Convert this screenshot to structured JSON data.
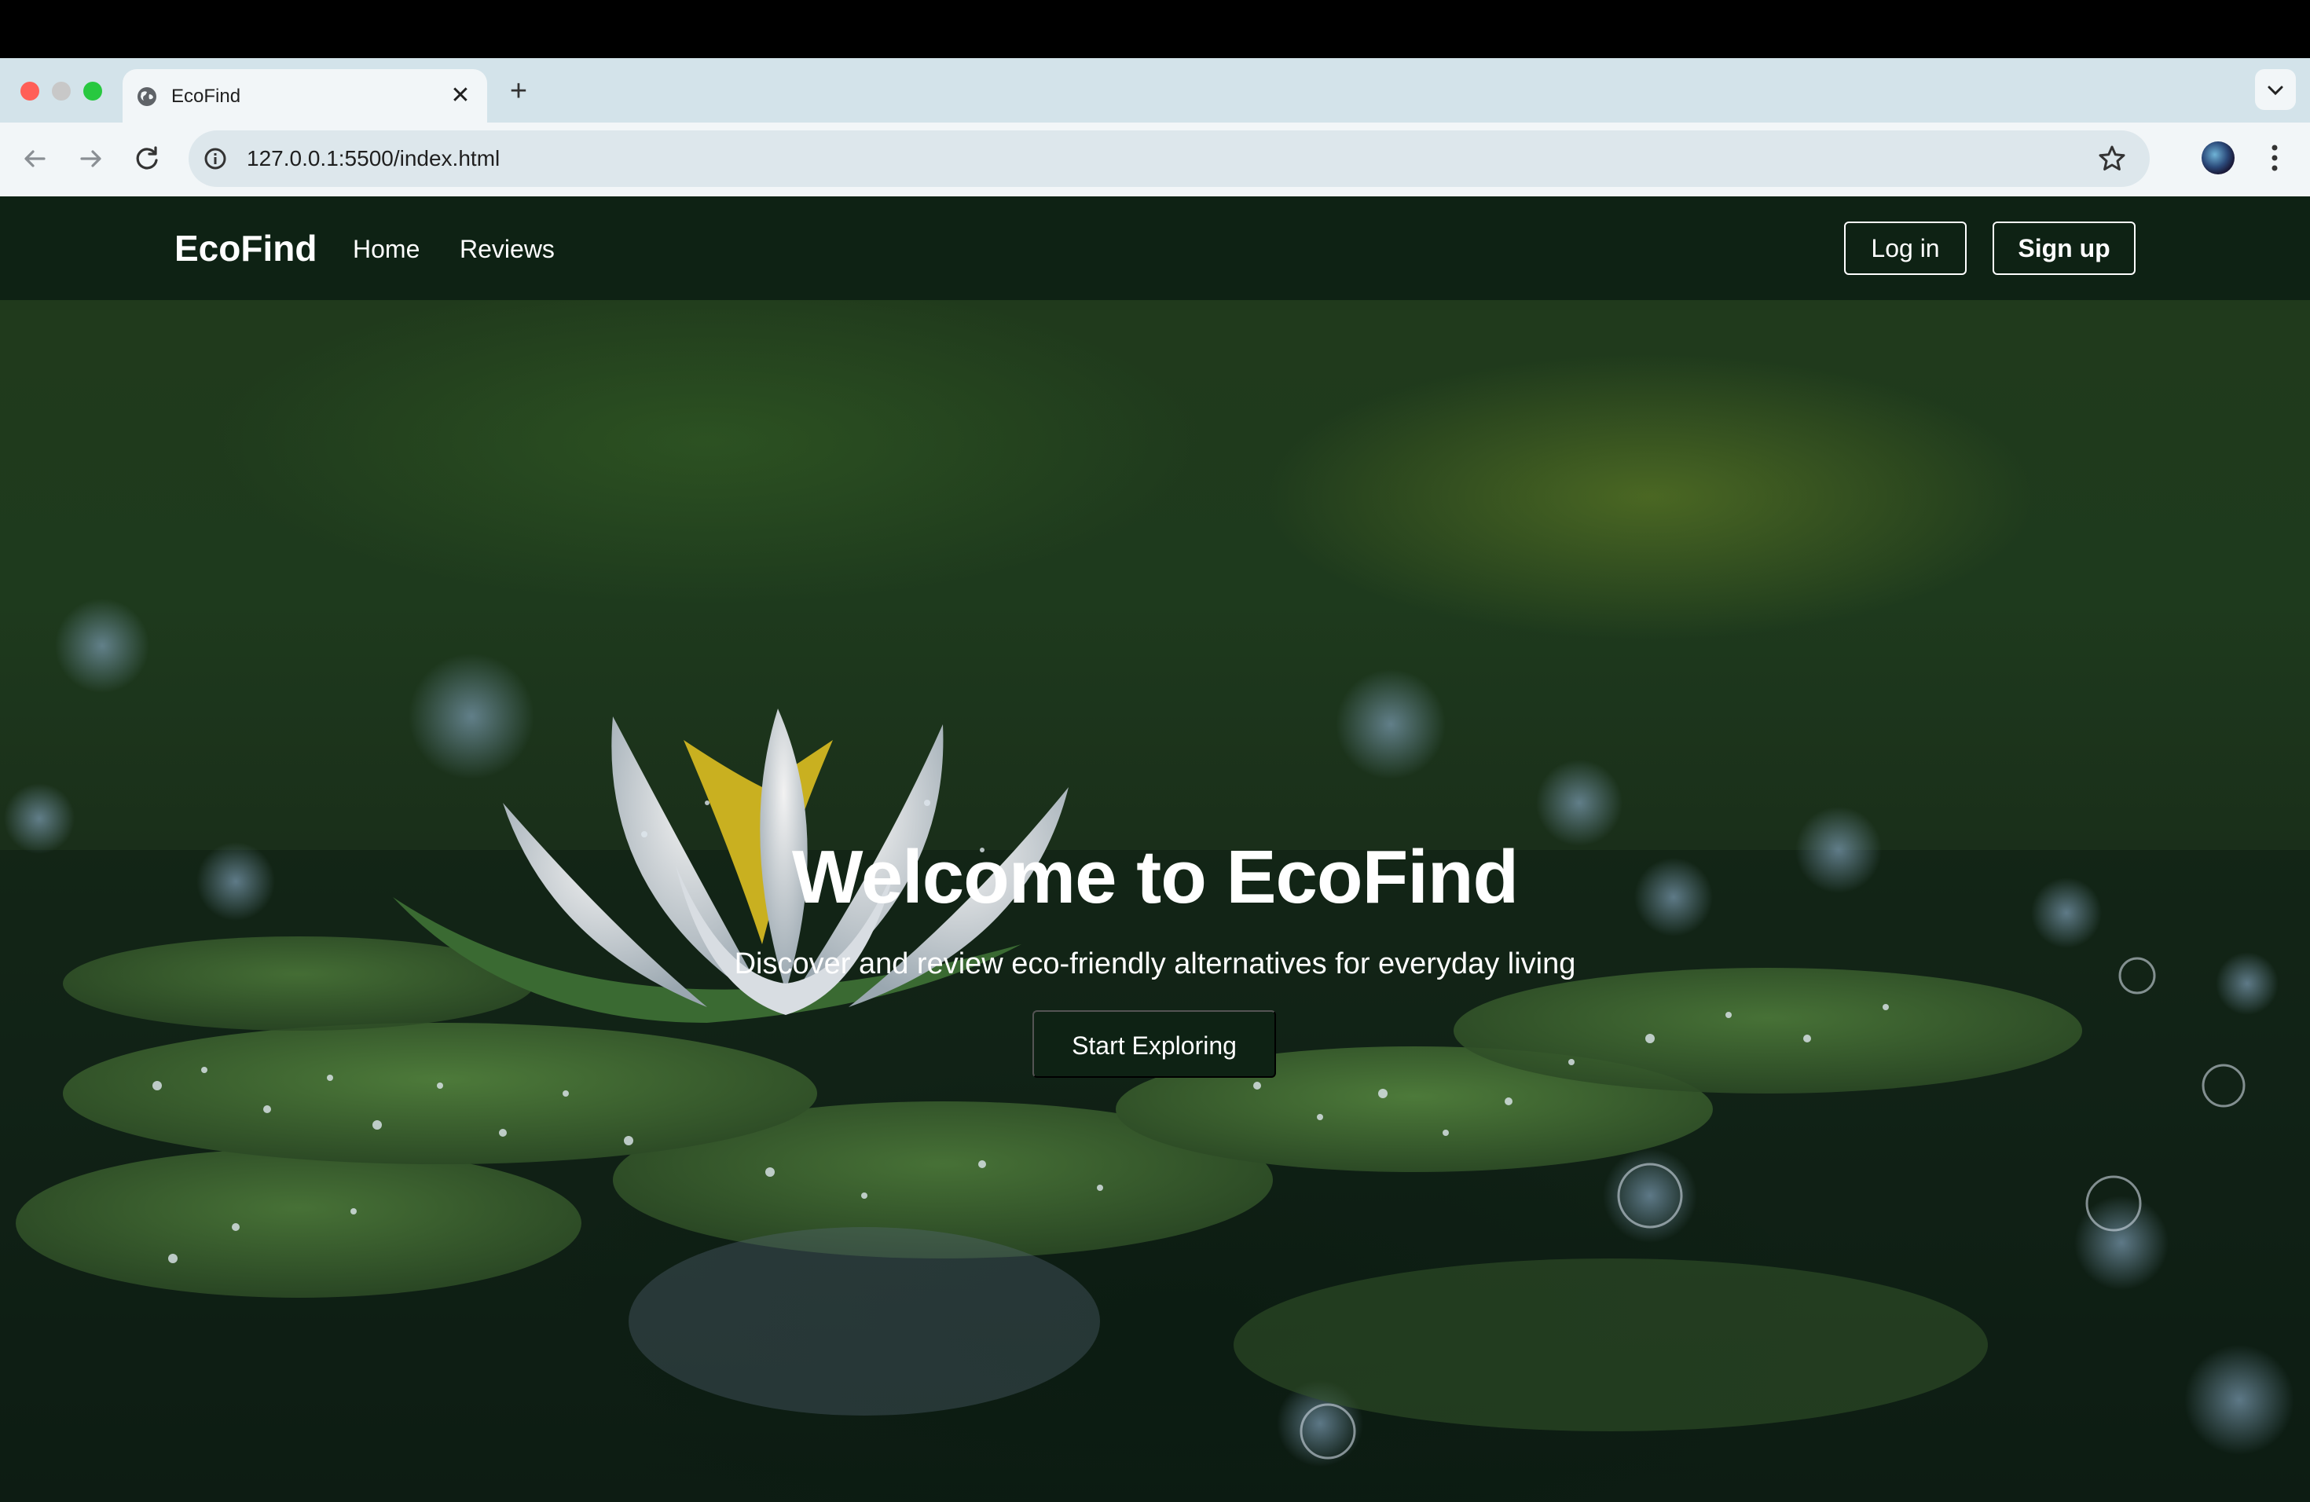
{
  "browser": {
    "tab_title": "EcoFind",
    "url": "127.0.0.1:5500/index.html",
    "tab_close": "✕",
    "new_tab": "+",
    "tab_menu": "⌄"
  },
  "navbar": {
    "brand": "EcoFind",
    "links": [
      "Home",
      "Reviews"
    ],
    "login_label": "Log in",
    "signup_label": "Sign up"
  },
  "hero": {
    "title": "Welcome to EcoFind",
    "subtitle": "Discover and review eco-friendly alternatives for everyday living",
    "cta_label": "Start Exploring"
  },
  "colors": {
    "navbar_bg": "#0e2214",
    "cta_bg": "#0e2214",
    "chrome_bg": "#d3e3ea"
  }
}
